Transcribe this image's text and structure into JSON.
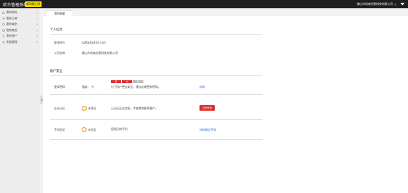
{
  "header": {
    "brand": "后台管理系统",
    "badge": "新功能上线",
    "company": "佛山市风来创意科技有限公司",
    "company_caret": "∨"
  },
  "sidebar": {
    "items": [
      {
        "label": "我的网站",
        "icon": "home-icon"
      },
      {
        "label": "我的订单",
        "icon": "cart-icon"
      },
      {
        "label": "我的域名",
        "icon": "globe-icon"
      },
      {
        "label": "我的商品",
        "icon": "package-icon"
      },
      {
        "label": "我的账户",
        "icon": "user-icon"
      },
      {
        "label": "系统管理",
        "icon": "gear-icon"
      }
    ],
    "chevron": "∨",
    "collapse_glyph": "◀"
  },
  "tabs": [
    {
      "label": "我的概要"
    }
  ],
  "personal": {
    "title": "个人信息",
    "email_label": "登录帐号",
    "email_value": "sgffgsf@163.com",
    "company_label": "公司名称",
    "company_value": "佛山市风来创意科技有限公司"
  },
  "security": {
    "title": "账户安全",
    "password": {
      "label": "登录密码",
      "strength_prefix": "强度：",
      "strength_value": "中",
      "bars": [
        "弱",
        "中",
        "强"
      ],
      "hint": "为了用户更加安全，建议定期更新密码。",
      "action": "修改"
    },
    "company_auth": {
      "label": "企业认证",
      "status": "未验证",
      "hint": "已认证企业信息，才能拿到推荐客户。",
      "action": "立即验证"
    },
    "phone_auth": {
      "label": "手机验证",
      "status": "未验证",
      "hint": "您验证的手机",
      "action": "修改绑定手机"
    }
  },
  "colors": {
    "topbar": "#1f1f1f",
    "badge": "#f5d90a",
    "accent_red": "#e02a2a",
    "link_blue": "#1e66d0",
    "warning": "#e38a15"
  }
}
